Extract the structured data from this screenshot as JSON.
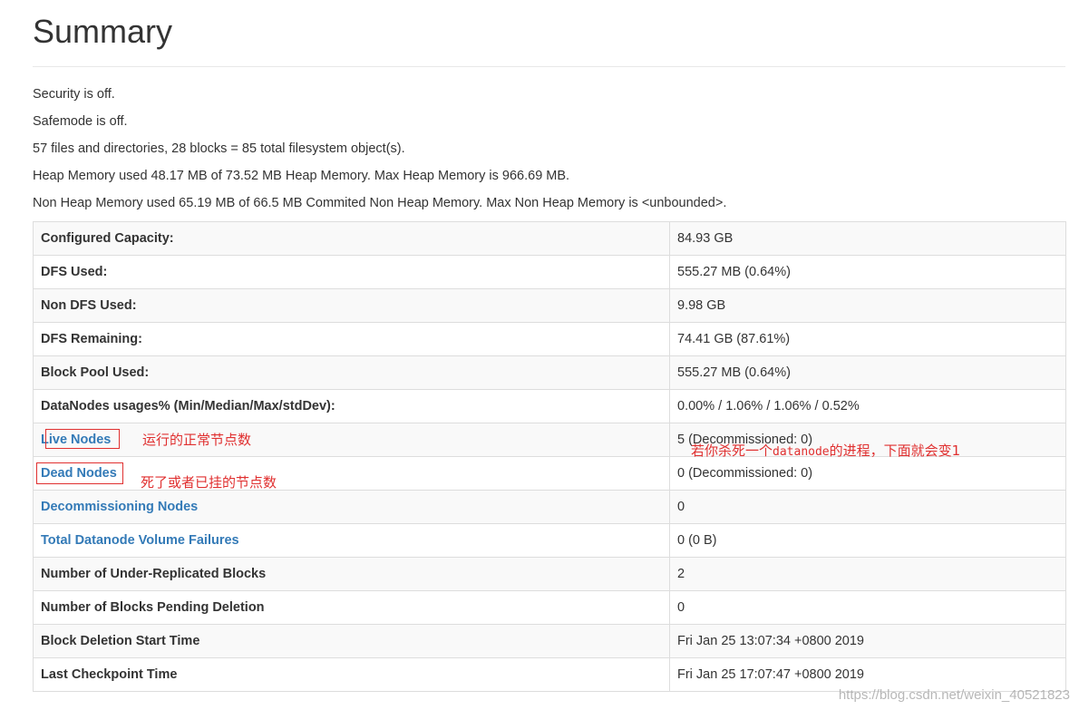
{
  "page": {
    "title": "Summary"
  },
  "info_lines": [
    "Security is off.",
    "Safemode is off.",
    "57 files and directories, 28 blocks = 85 total filesystem object(s).",
    "Heap Memory used 48.17 MB of 73.52 MB Heap Memory. Max Heap Memory is 966.69 MB.",
    "Non Heap Memory used 65.19 MB of 66.5 MB Commited Non Heap Memory. Max Non Heap Memory is <unbounded>."
  ],
  "table": {
    "rows": [
      {
        "label": "Configured Capacity:",
        "value": "84.93 GB"
      },
      {
        "label": "DFS Used:",
        "value": "555.27 MB (0.64%)"
      },
      {
        "label": "Non DFS Used:",
        "value": "9.98 GB"
      },
      {
        "label": "DFS Remaining:",
        "value": "74.41 GB (87.61%)"
      },
      {
        "label": "Block Pool Used:",
        "value": "555.27 MB (0.64%)"
      },
      {
        "label": "DataNodes usages% (Min/Median/Max/stdDev):",
        "value": "0.00% / 1.06% / 1.06% / 0.52%"
      },
      {
        "label": "Live Nodes",
        "value": "5 (Decommissioned: 0)"
      },
      {
        "label": "Dead Nodes",
        "value": "0 (Decommissioned: 0)"
      },
      {
        "label": "Decommissioning Nodes",
        "value": "0"
      },
      {
        "label": "Total Datanode Volume Failures",
        "value": "0 (0 B)"
      },
      {
        "label": "Number of Under-Replicated Blocks",
        "value": "2"
      },
      {
        "label": "Number of Blocks Pending Deletion",
        "value": "0"
      },
      {
        "label": "Block Deletion Start Time",
        "value": "Fri Jan 25 13:07:34 +0800 2019"
      },
      {
        "label": "Last Checkpoint Time",
        "value": "Fri Jan 25 17:07:47 +0800 2019"
      }
    ]
  },
  "annotations": {
    "live_nodes_note": "运行的正常节点数",
    "dead_nodes_note": "死了或者已挂的节点数",
    "kill_note_prefix": "若你杀死一个",
    "kill_note_code": "datanode",
    "kill_note_suffix": "的进程，下面就会变1"
  },
  "watermark": "https://blog.csdn.net/weixin_40521823",
  "colors": {
    "link": "#337ab7",
    "annotation": "#e03030",
    "stripe": "#f9f9f9",
    "border": "#dddddd"
  }
}
